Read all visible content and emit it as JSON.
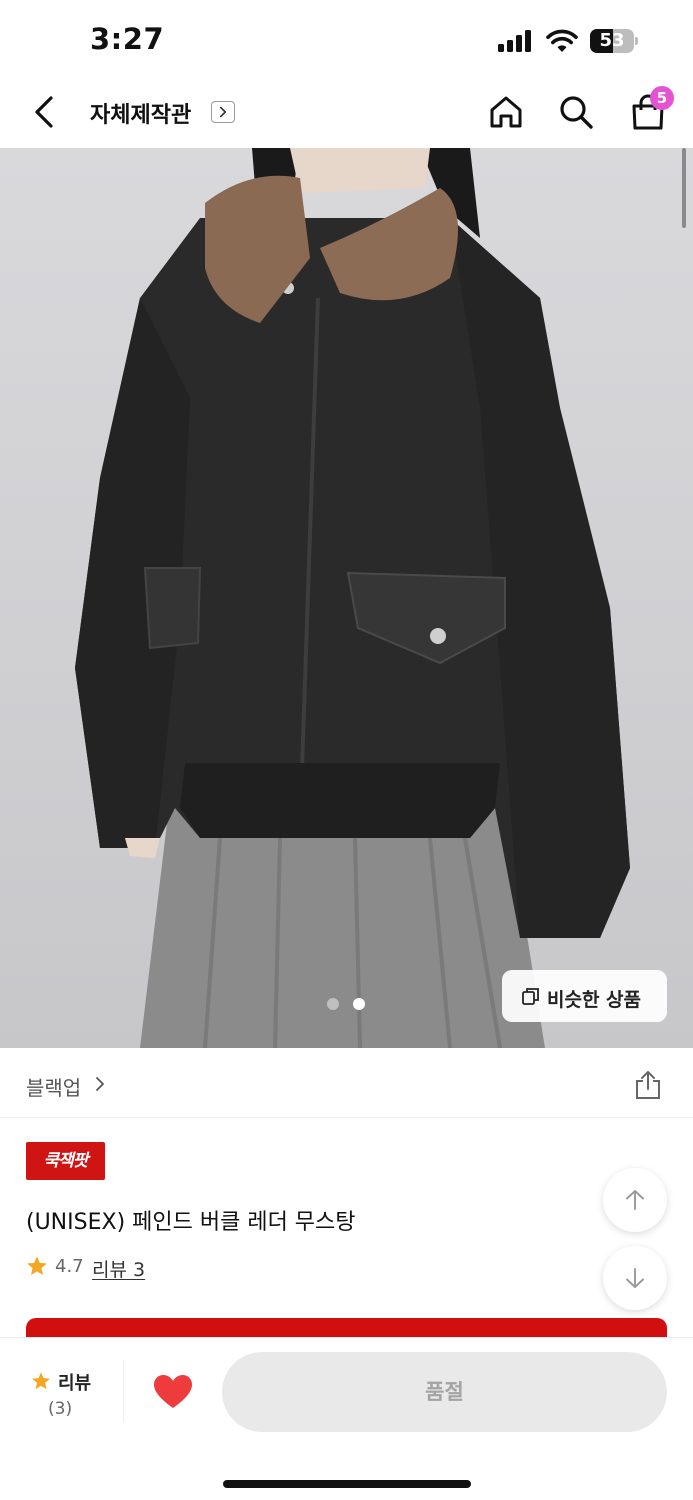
{
  "status_bar": {
    "time": "3:27",
    "battery_level": "53"
  },
  "header": {
    "store_name": "자체제작관",
    "cart_count": "5",
    "icons": [
      "back-icon",
      "chevron-right-icon",
      "home-icon",
      "search-icon",
      "shopping-bag-icon"
    ]
  },
  "gallery": {
    "image": "black leather jacket with brown fur collar",
    "page_count": 2,
    "current_page": 2,
    "similar_label": "비슷한 상품"
  },
  "brand": {
    "name": "블랙업",
    "icons": [
      "chevron-right-icon",
      "share-icon"
    ]
  },
  "product": {
    "promo_badge": "쿡잭팟",
    "title": "(UNISEX) 페인드 버클 레더 무스탕",
    "rating": "4.7",
    "review_link": "리뷰 3"
  },
  "bottom_bar": {
    "review_label": "리뷰",
    "review_count": "(3)",
    "soldout_label": "품절"
  },
  "colors": {
    "accent_red": "#d10f0f",
    "badge_pink": "#e553d5",
    "star": "#f5a623",
    "heart": "#ee3b3b"
  }
}
